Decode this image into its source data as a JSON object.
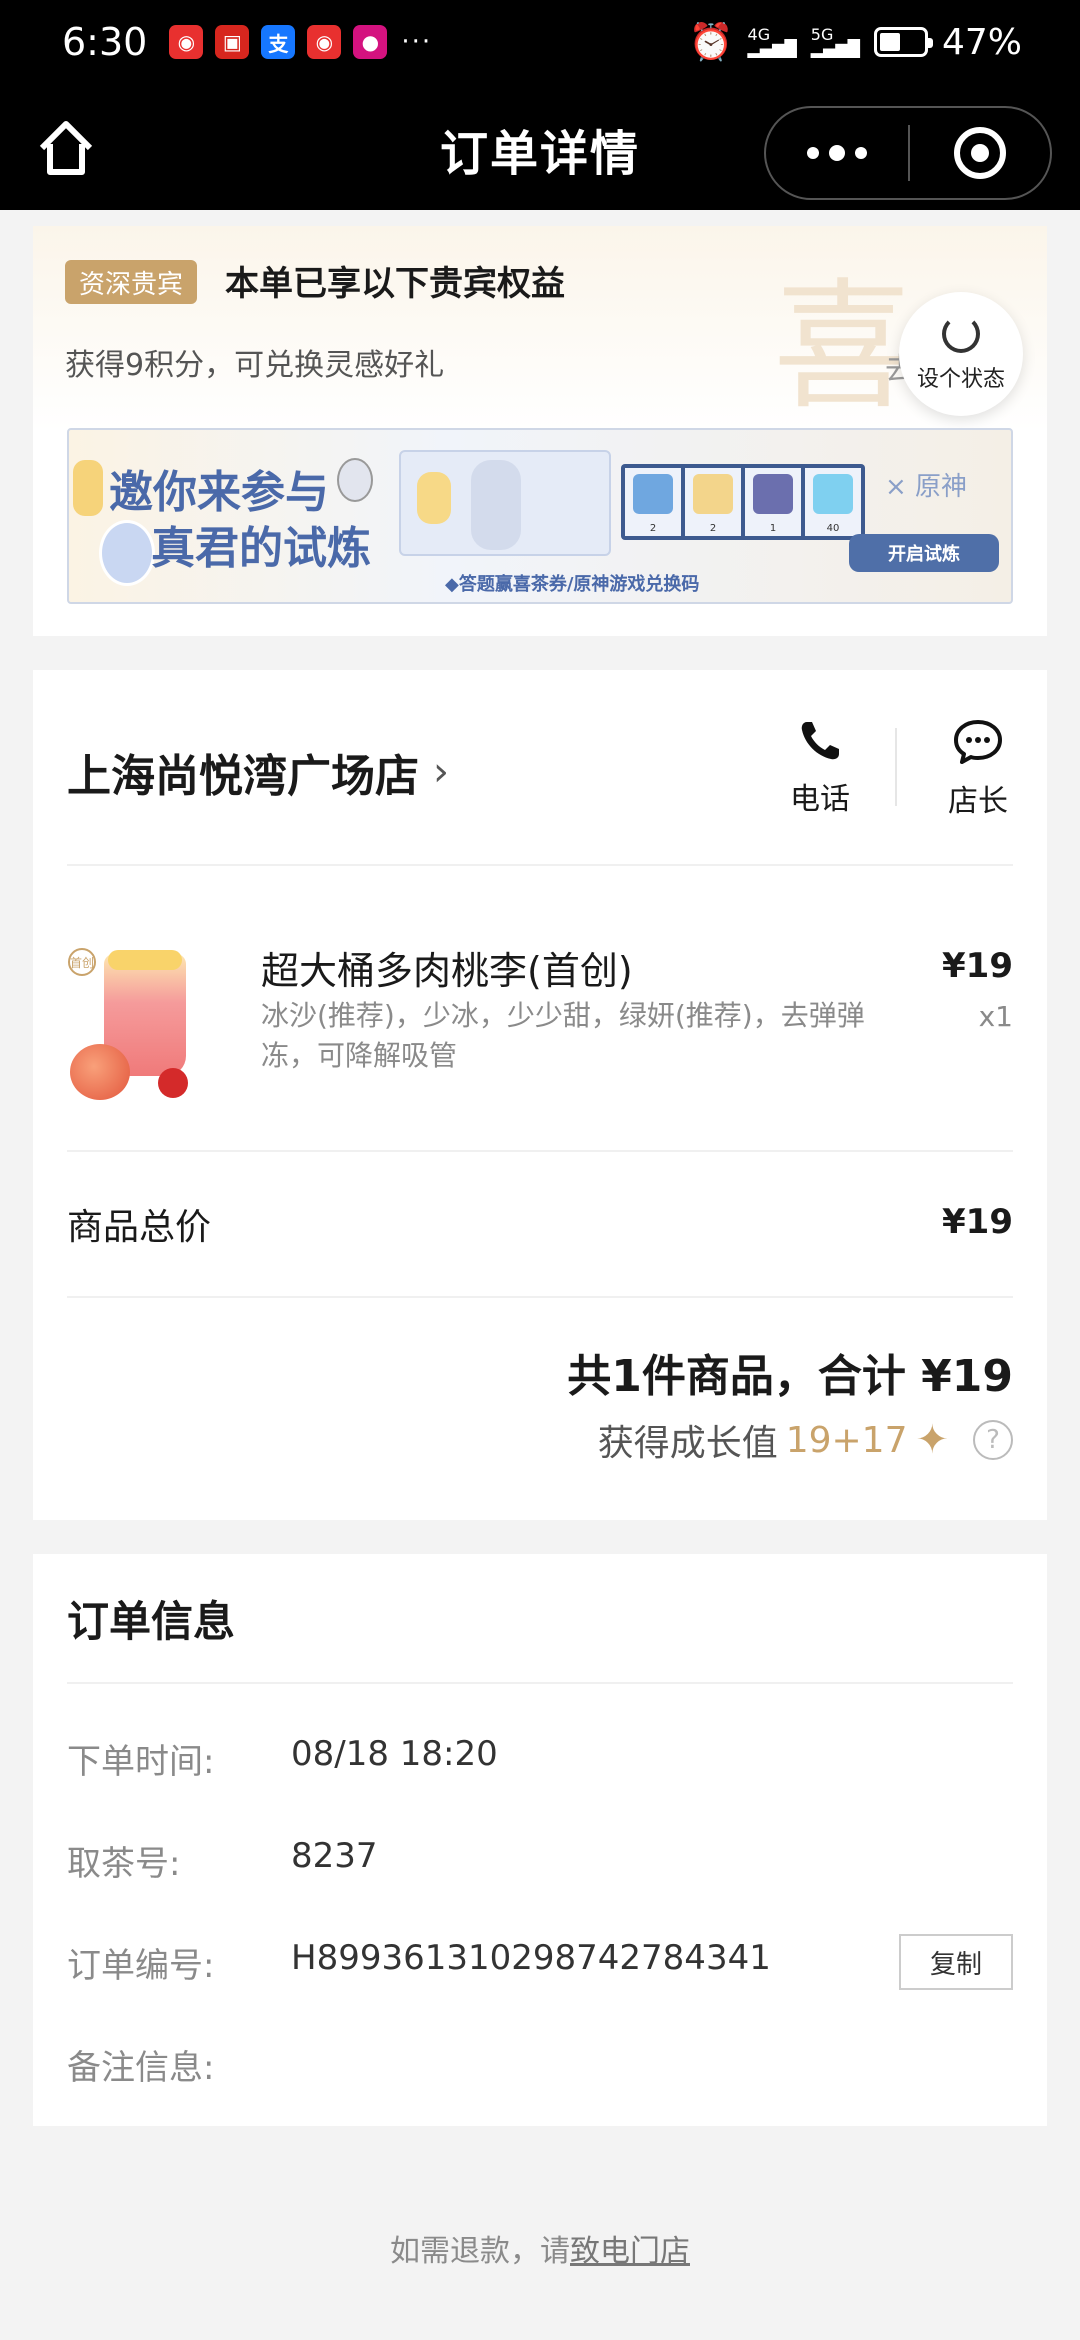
{
  "status_bar": {
    "time": "6:30",
    "more_dots": "···",
    "net1": "4G",
    "net2": "5G",
    "battery": "47%",
    "battery_level": 0.47
  },
  "header": {
    "title": "订单详情"
  },
  "vip": {
    "badge": "资深贵宾",
    "title": "本单已享以下贵宾权益",
    "subtitle": "获得9积分，可兑换灵感好礼",
    "watermark": "喜",
    "cut_text": "去",
    "status_button": "设个状态",
    "banner": {
      "title_line1": "邀你来参与",
      "title_line2": "真君的试炼",
      "tagline": "◆答题赢喜茶券/原神游戏兑换码",
      "brand": "× 原神",
      "button": "开启试炼",
      "item_counts": [
        "2",
        "2",
        "1",
        "40"
      ]
    }
  },
  "store": {
    "name": "上海尚悦湾广场店",
    "phone_label": "电话",
    "manager_label": "店长"
  },
  "product": {
    "name": "超大桶多肉桃李(首创)",
    "spec": "冰沙(推荐)，少冰，少少甜，绿妍(推荐)，去弹弹冻，可降解吸管",
    "price": "¥19",
    "qty": "x1",
    "img_tag": "首创"
  },
  "summary": {
    "subtotal_label": "商品总价",
    "subtotal_value": "¥19",
    "total": "共1件商品，合计 ¥19",
    "growth_label": "获得成长值",
    "growth_value": "19+17",
    "growth_icon": "✦",
    "help_icon": "?"
  },
  "order_info": {
    "title": "订单信息",
    "time_label": "下单时间:",
    "time_value": "08/18 18:20",
    "pickup_label": "取茶号:",
    "pickup_value": "8237",
    "number_label": "订单编号:",
    "number_value": "H899361310298742784341",
    "copy_label": "复制",
    "note_label": "备注信息:"
  },
  "footer": {
    "refund_text": "如需退款，请",
    "refund_link": "致电门店"
  }
}
